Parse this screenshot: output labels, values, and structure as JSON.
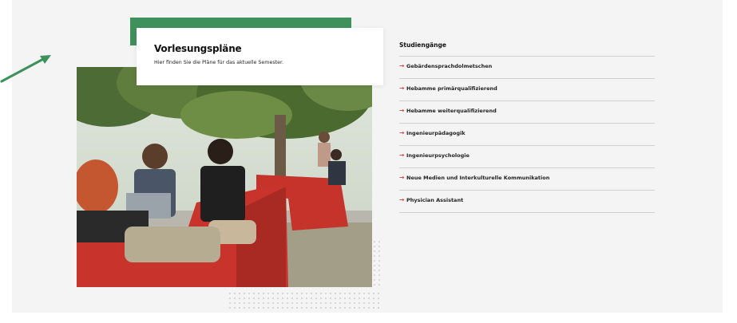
{
  "colors": {
    "accent_green": "#3f915b",
    "arrow_red": "#d23a3a",
    "panel_background": "#f4f4f4"
  },
  "decor": {
    "arrow_icon": "arrow-up-right-icon"
  },
  "feature": {
    "title": "Vorlesungspläne",
    "subtitle": "Hier finden Sie die Pläne für das aktuelle Semester.",
    "photo": "students-on-red-benches-photo"
  },
  "programs": {
    "heading": "Studiengänge",
    "items": [
      {
        "label": "Gebärdensprachdolmetschen",
        "icon": "arrow-right-icon"
      },
      {
        "label": "Hebamme primärqualifizierend",
        "icon": "arrow-right-icon"
      },
      {
        "label": "Hebamme weiterqualifizierend",
        "icon": "arrow-right-icon"
      },
      {
        "label": "Ingenieurpädagogik",
        "icon": "arrow-right-icon"
      },
      {
        "label": "Ingenieurpsychologie",
        "icon": "arrow-right-icon"
      },
      {
        "label": "Neue Medien und Interkulturelle Kommunikation",
        "icon": "arrow-right-icon"
      },
      {
        "label": "Physician Assistant",
        "icon": "arrow-right-icon"
      }
    ]
  }
}
